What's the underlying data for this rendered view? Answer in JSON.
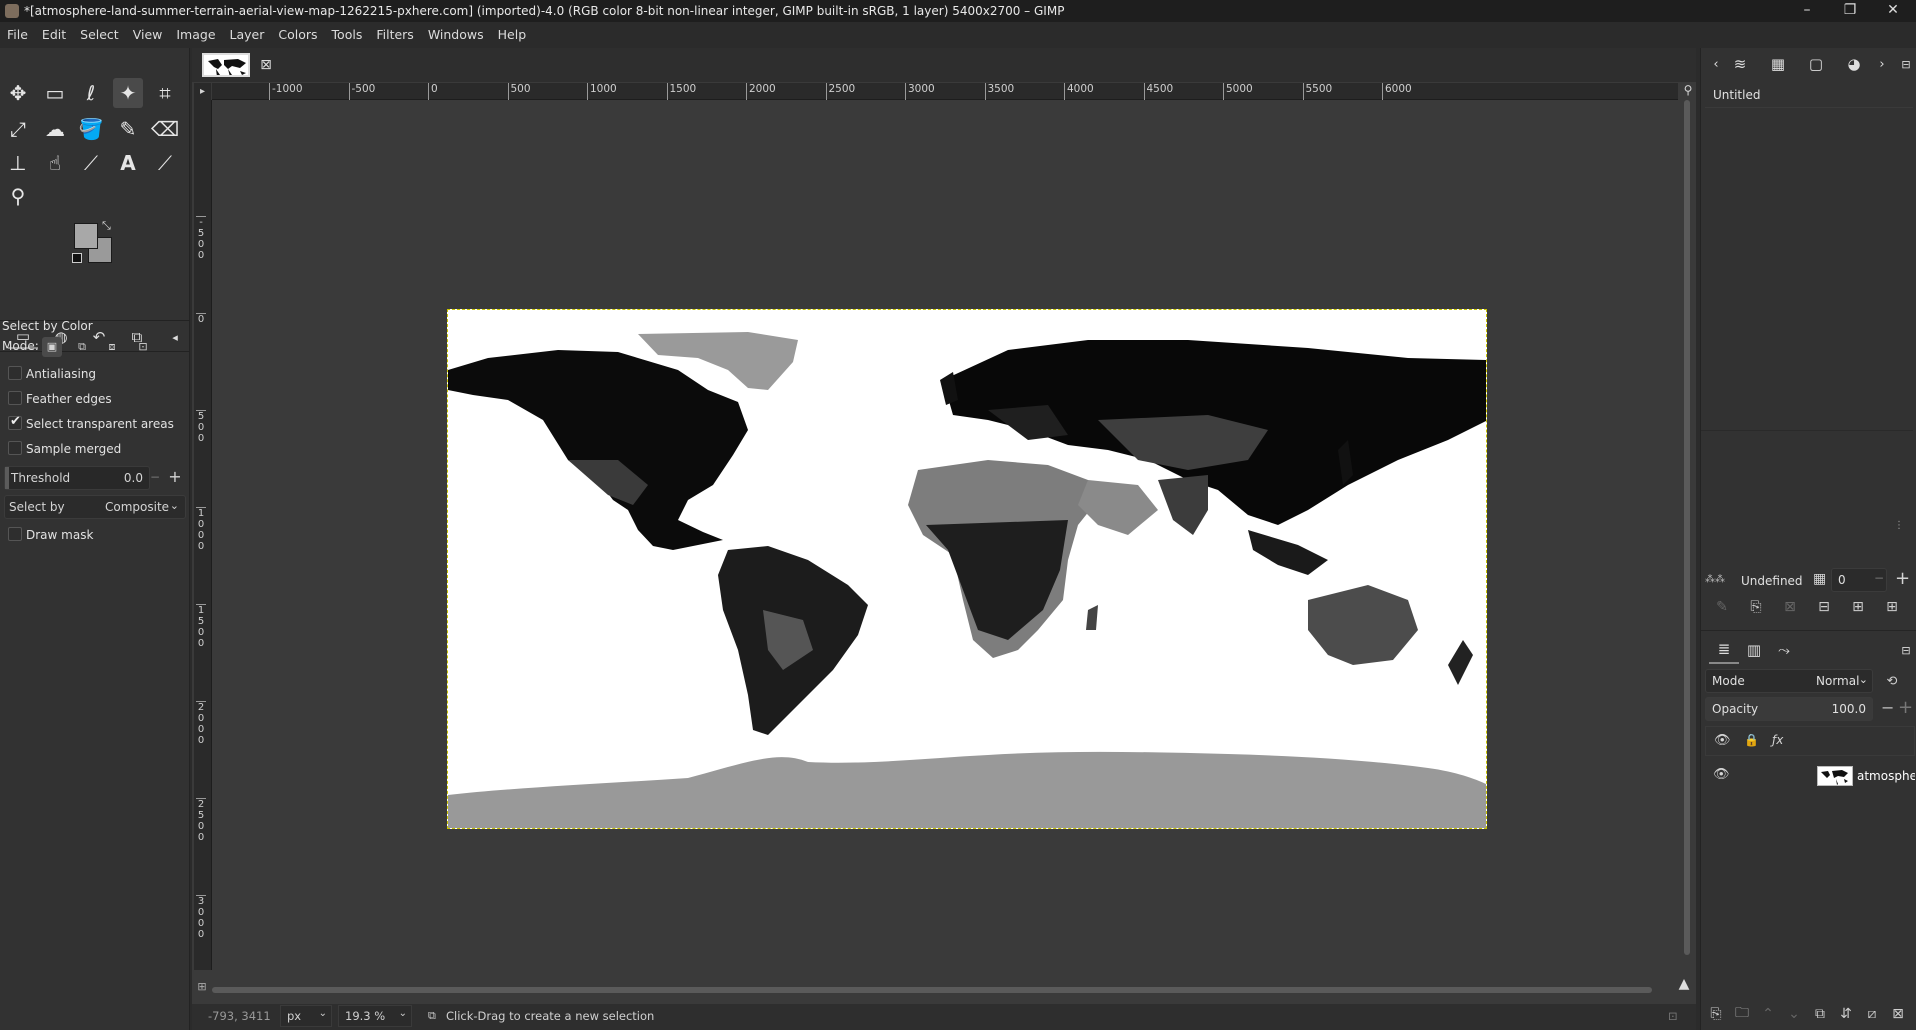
{
  "window": {
    "title": "*[atmosphere-land-summer-terrain-aerial-view-map-1262215-pxhere.com] (imported)-4.0 (RGB color 8-bit non-linear integer, GIMP built-in sRGB, 1 layer) 5400x2700 – GIMP",
    "controls": [
      "–",
      "❐",
      "✕"
    ]
  },
  "menu": [
    "File",
    "Edit",
    "Select",
    "View",
    "Image",
    "Layer",
    "Colors",
    "Tools",
    "Filters",
    "Windows",
    "Help"
  ],
  "toolbox": {
    "tools": [
      {
        "name": "move-tool",
        "glyph": "✥"
      },
      {
        "name": "rect-select-tool",
        "glyph": "▭"
      },
      {
        "name": "free-select-tool",
        "glyph": "ℓ"
      },
      {
        "name": "fuzzy-select-tool",
        "glyph": "✦",
        "active": true
      },
      {
        "name": "crop-tool",
        "glyph": "⌗"
      },
      {
        "name": "transform-tool",
        "glyph": "⤢"
      },
      {
        "name": "warp-tool",
        "glyph": "☁"
      },
      {
        "name": "bucket-fill-tool",
        "glyph": "🪣"
      },
      {
        "name": "paintbrush-tool",
        "glyph": "✎"
      },
      {
        "name": "eraser-tool",
        "glyph": "⌫"
      },
      {
        "name": "clone-tool",
        "glyph": "⊥"
      },
      {
        "name": "smudge-tool",
        "glyph": "☝"
      },
      {
        "name": "paths-tool",
        "glyph": "⟋"
      },
      {
        "name": "text-tool",
        "glyph": "A"
      },
      {
        "name": "color-picker-tool",
        "glyph": "⟋"
      },
      {
        "name": "zoom-tool",
        "glyph": "⚲"
      }
    ]
  },
  "tool_options": {
    "title": "Select by Color",
    "mode_label": "Mode:",
    "antialiasing": "Antialiasing",
    "feather_edges": "Feather edges",
    "select_transparent": "Select transparent areas",
    "sample_merged": "Sample merged",
    "threshold_label": "Threshold",
    "threshold_value": "0.0",
    "select_by_label": "Select by",
    "select_by_value": "Composite",
    "draw_mask": "Draw mask"
  },
  "ruler": {
    "h_labels": [
      "-1000",
      "-500",
      "0",
      "500",
      "1000",
      "1500",
      "2000",
      "2500",
      "3000",
      "3500",
      "4000",
      "4500",
      "5000",
      "5500",
      "6000"
    ],
    "v_labels": [
      "-500",
      "0",
      "500",
      "1000",
      "1500",
      "2000",
      "2500",
      "3000"
    ]
  },
  "status": {
    "coords": "-793, 3411",
    "unit": "px",
    "zoom": "19.3 %",
    "message": "Click-Drag to create a new selection"
  },
  "right_dock": {
    "images_item": "Untitled",
    "brush_mode": "Undefined",
    "spacing_value": "0",
    "mode_label": "Mode",
    "mode_value": "Normal",
    "opacity_label": "Opacity",
    "opacity_value": "100.0",
    "layer_name": "atmosphere"
  }
}
